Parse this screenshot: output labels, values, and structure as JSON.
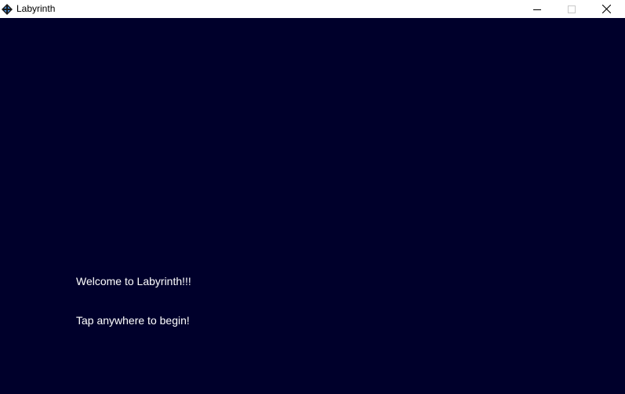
{
  "window": {
    "title": "Labyrinth",
    "icon": "labyrinth-app-icon",
    "controls": {
      "minimize_icon": "minimize-icon",
      "maximize_icon": "maximize-icon",
      "close_icon": "close-icon"
    }
  },
  "game": {
    "background_color": "#00002b",
    "text_color": "#ffffff",
    "welcome_message": "Welcome to Labyrinth!!!",
    "start_prompt": "Tap anywhere to begin!"
  }
}
